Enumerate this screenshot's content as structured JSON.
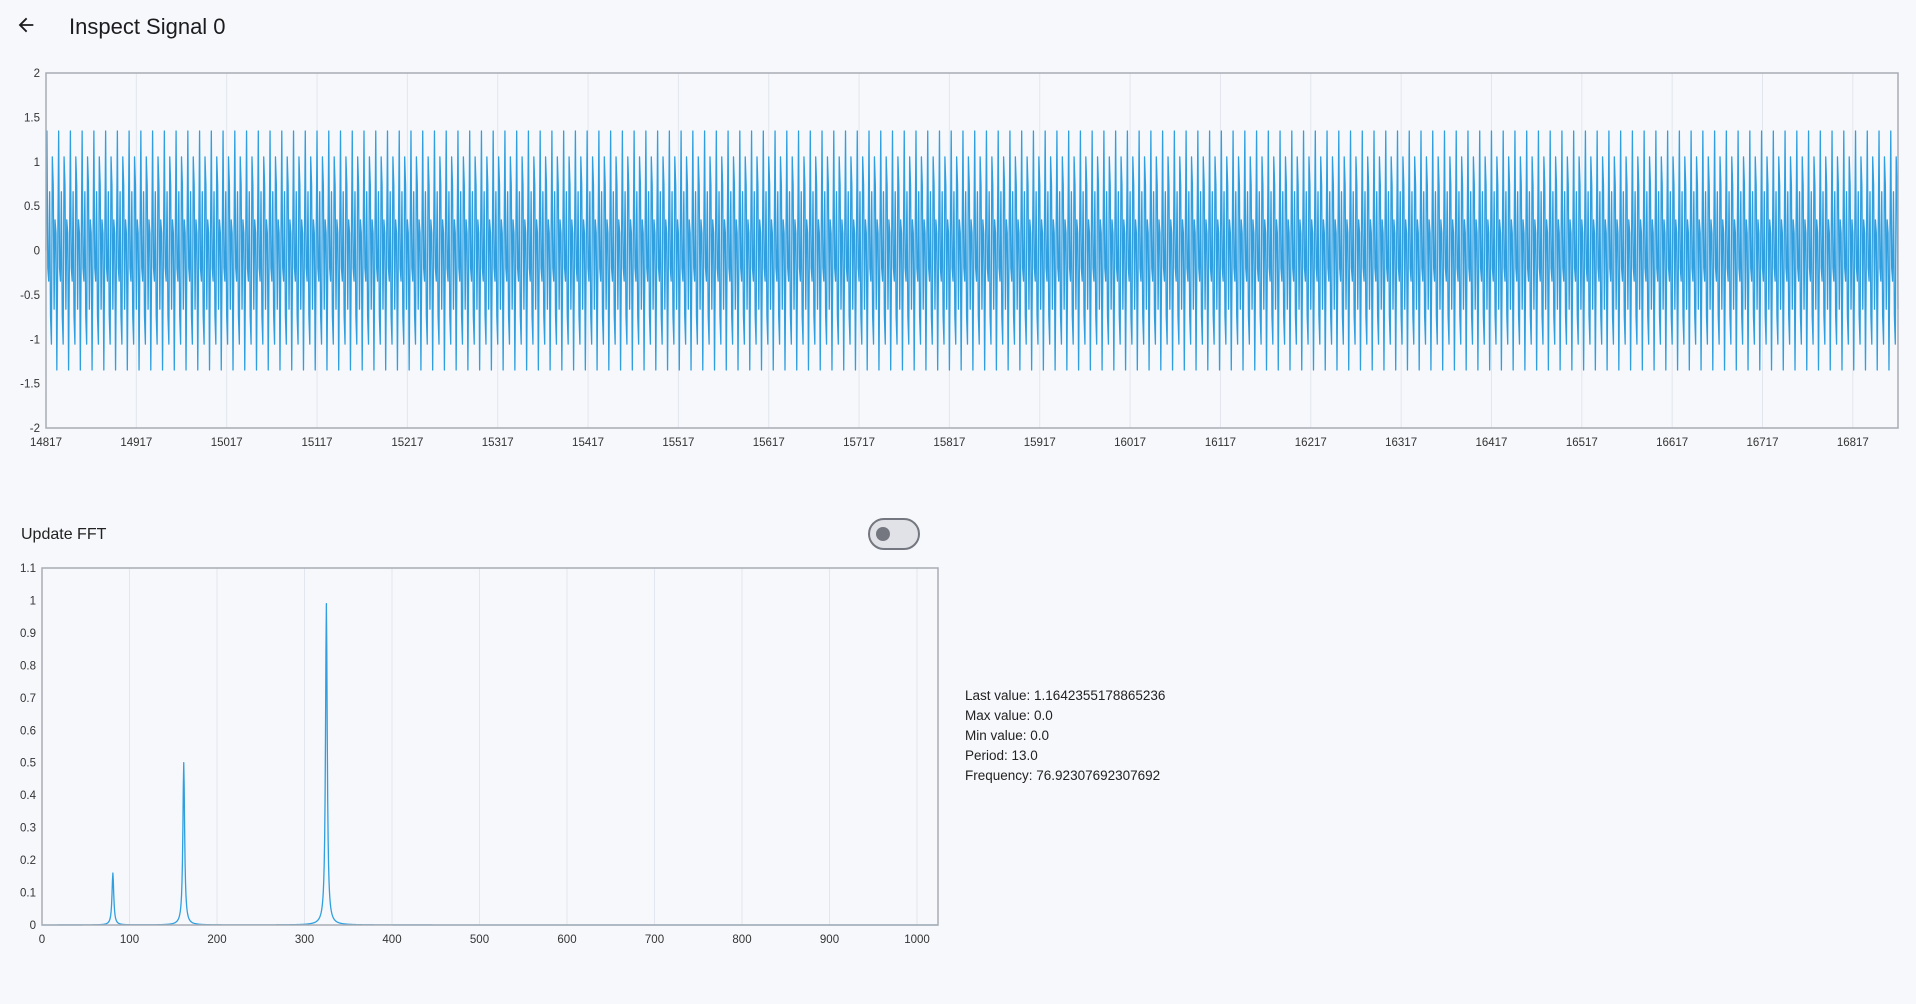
{
  "page": {
    "title": "Inspect Signal 0",
    "back_icon": "arrow-left-icon"
  },
  "colors": {
    "line": "#2f9fe0",
    "grid": "#e3e6ee",
    "frame": "#a9acb4",
    "background": "#f7f8fc"
  },
  "fft_toggle": {
    "label": "Update FFT",
    "state": "off"
  },
  "stats": {
    "last_value": "Last value: 1.1642355178865236",
    "max_value": "Max value: 0.0",
    "min_value": "Min value: 0.0",
    "period": "Period: 13.0",
    "frequency": "Frequency: 76.92307692307692"
  },
  "chart_data": [
    {
      "type": "line",
      "title": "",
      "xlabel": "",
      "ylabel": "",
      "xlim": [
        14817,
        16867
      ],
      "ylim": [
        -2,
        2
      ],
      "x_ticks": [
        "14817",
        "14917",
        "15017",
        "15117",
        "15217",
        "15317",
        "15417",
        "15517",
        "15617",
        "15717",
        "15817",
        "15917",
        "16017",
        "16117",
        "16217",
        "16317",
        "16417",
        "16517",
        "16617",
        "16717",
        "16817"
      ],
      "y_ticks": [
        "-2",
        "-1.5",
        "-1",
        "-0.5",
        "0",
        "0.5",
        "1",
        "1.5",
        "2"
      ],
      "grid": true,
      "series": [
        {
          "x_start": 14817,
          "x_step": 1,
          "length": 2051,
          "formula_components": [
            {
              "amplitude": 1.0,
              "period": 3.25
            },
            {
              "amplitude": 0.5,
              "period": 6.5
            }
          ]
        }
      ]
    },
    {
      "type": "line",
      "title": "",
      "xlabel": "",
      "ylabel": "",
      "xlim": [
        0,
        1024
      ],
      "ylim": [
        0,
        1.1
      ],
      "x_ticks": [
        "0",
        "100",
        "200",
        "300",
        "400",
        "500",
        "600",
        "700",
        "800",
        "900",
        "1000"
      ],
      "y_ticks": [
        "0",
        "0.1",
        "0.2",
        "0.3",
        "0.4",
        "0.5",
        "0.6",
        "0.7",
        "0.8",
        "0.9",
        "1",
        "1.1"
      ],
      "grid": true,
      "series": [
        {
          "peaks": [
            {
              "x": 81,
              "y": 0.16
            },
            {
              "x": 162,
              "y": 0.5
            },
            {
              "x": 325,
              "y": 0.99
            }
          ]
        }
      ]
    }
  ]
}
